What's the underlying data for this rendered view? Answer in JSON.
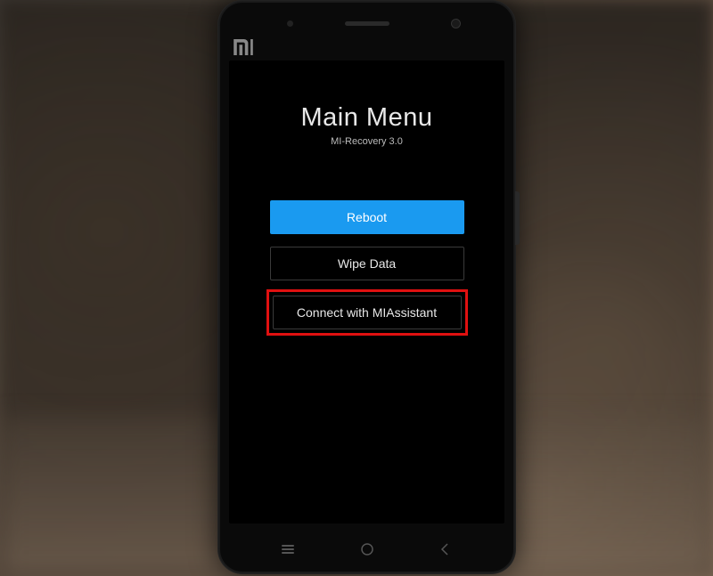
{
  "screen": {
    "title": "Main Menu",
    "subtitle": "MI-Recovery 3.0",
    "options": {
      "reboot": "Reboot",
      "wipe": "Wipe Data",
      "assistant": "Connect with MIAssistant"
    },
    "selected": "reboot",
    "highlighted": "assistant"
  }
}
